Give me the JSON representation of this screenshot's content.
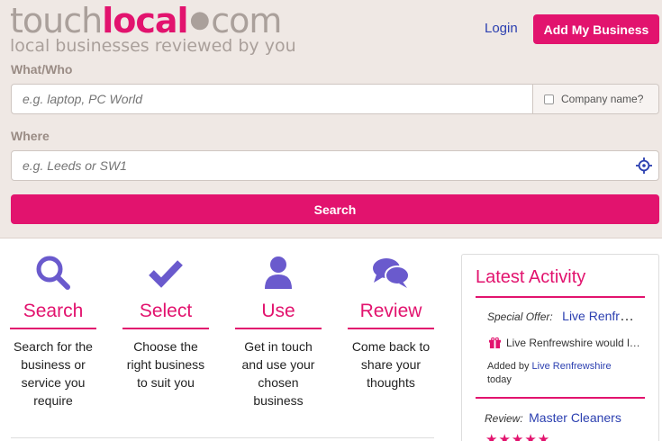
{
  "logo": {
    "part1": "touch",
    "part2": "local",
    "dot": "●",
    "part3": "com",
    "tagline": "local businesses reviewed by you"
  },
  "header": {
    "login": "Login",
    "add_business": "Add My Business"
  },
  "search": {
    "what_label": "What/Who",
    "what_placeholder": "e.g. laptop, PC World",
    "company_label": "Company name?",
    "where_label": "Where",
    "where_placeholder": "e.g. Leeds or SW1",
    "button": "Search"
  },
  "steps": [
    {
      "icon": "search-icon",
      "title": "Search",
      "desc_lines": [
        "Search for the",
        "business or",
        "service you",
        "require"
      ]
    },
    {
      "icon": "check-icon",
      "title": "Select",
      "desc_lines": [
        "Choose the",
        "right business",
        "to suit you"
      ]
    },
    {
      "icon": "user-icon",
      "title": "Use",
      "desc_lines": [
        "Get in touch",
        "and use your",
        "chosen",
        "business"
      ]
    },
    {
      "icon": "chat-bubbles-icon",
      "title": "Review",
      "desc_lines": [
        "Come back to",
        "share your",
        "thoughts"
      ]
    }
  ],
  "activity": {
    "title": "Latest Activity",
    "item1": {
      "label": "Special Offer:",
      "link": "Live Renfrewshire",
      "offer_icon": "gift-icon",
      "offer_text": "Live Renfrewshire would like to offer",
      "added_by_label": "Added by",
      "added_by_link": "Live Renfrewshire",
      "when": "today"
    },
    "item2": {
      "label": "Review:",
      "link": "Master Cleaners",
      "stars": "★★★★★",
      "rating": 5
    }
  },
  "colors": {
    "brand": "#e2136e",
    "link": "#2b3fb0",
    "icon": "#6a5acd",
    "header_bg": "#efe8e4"
  }
}
